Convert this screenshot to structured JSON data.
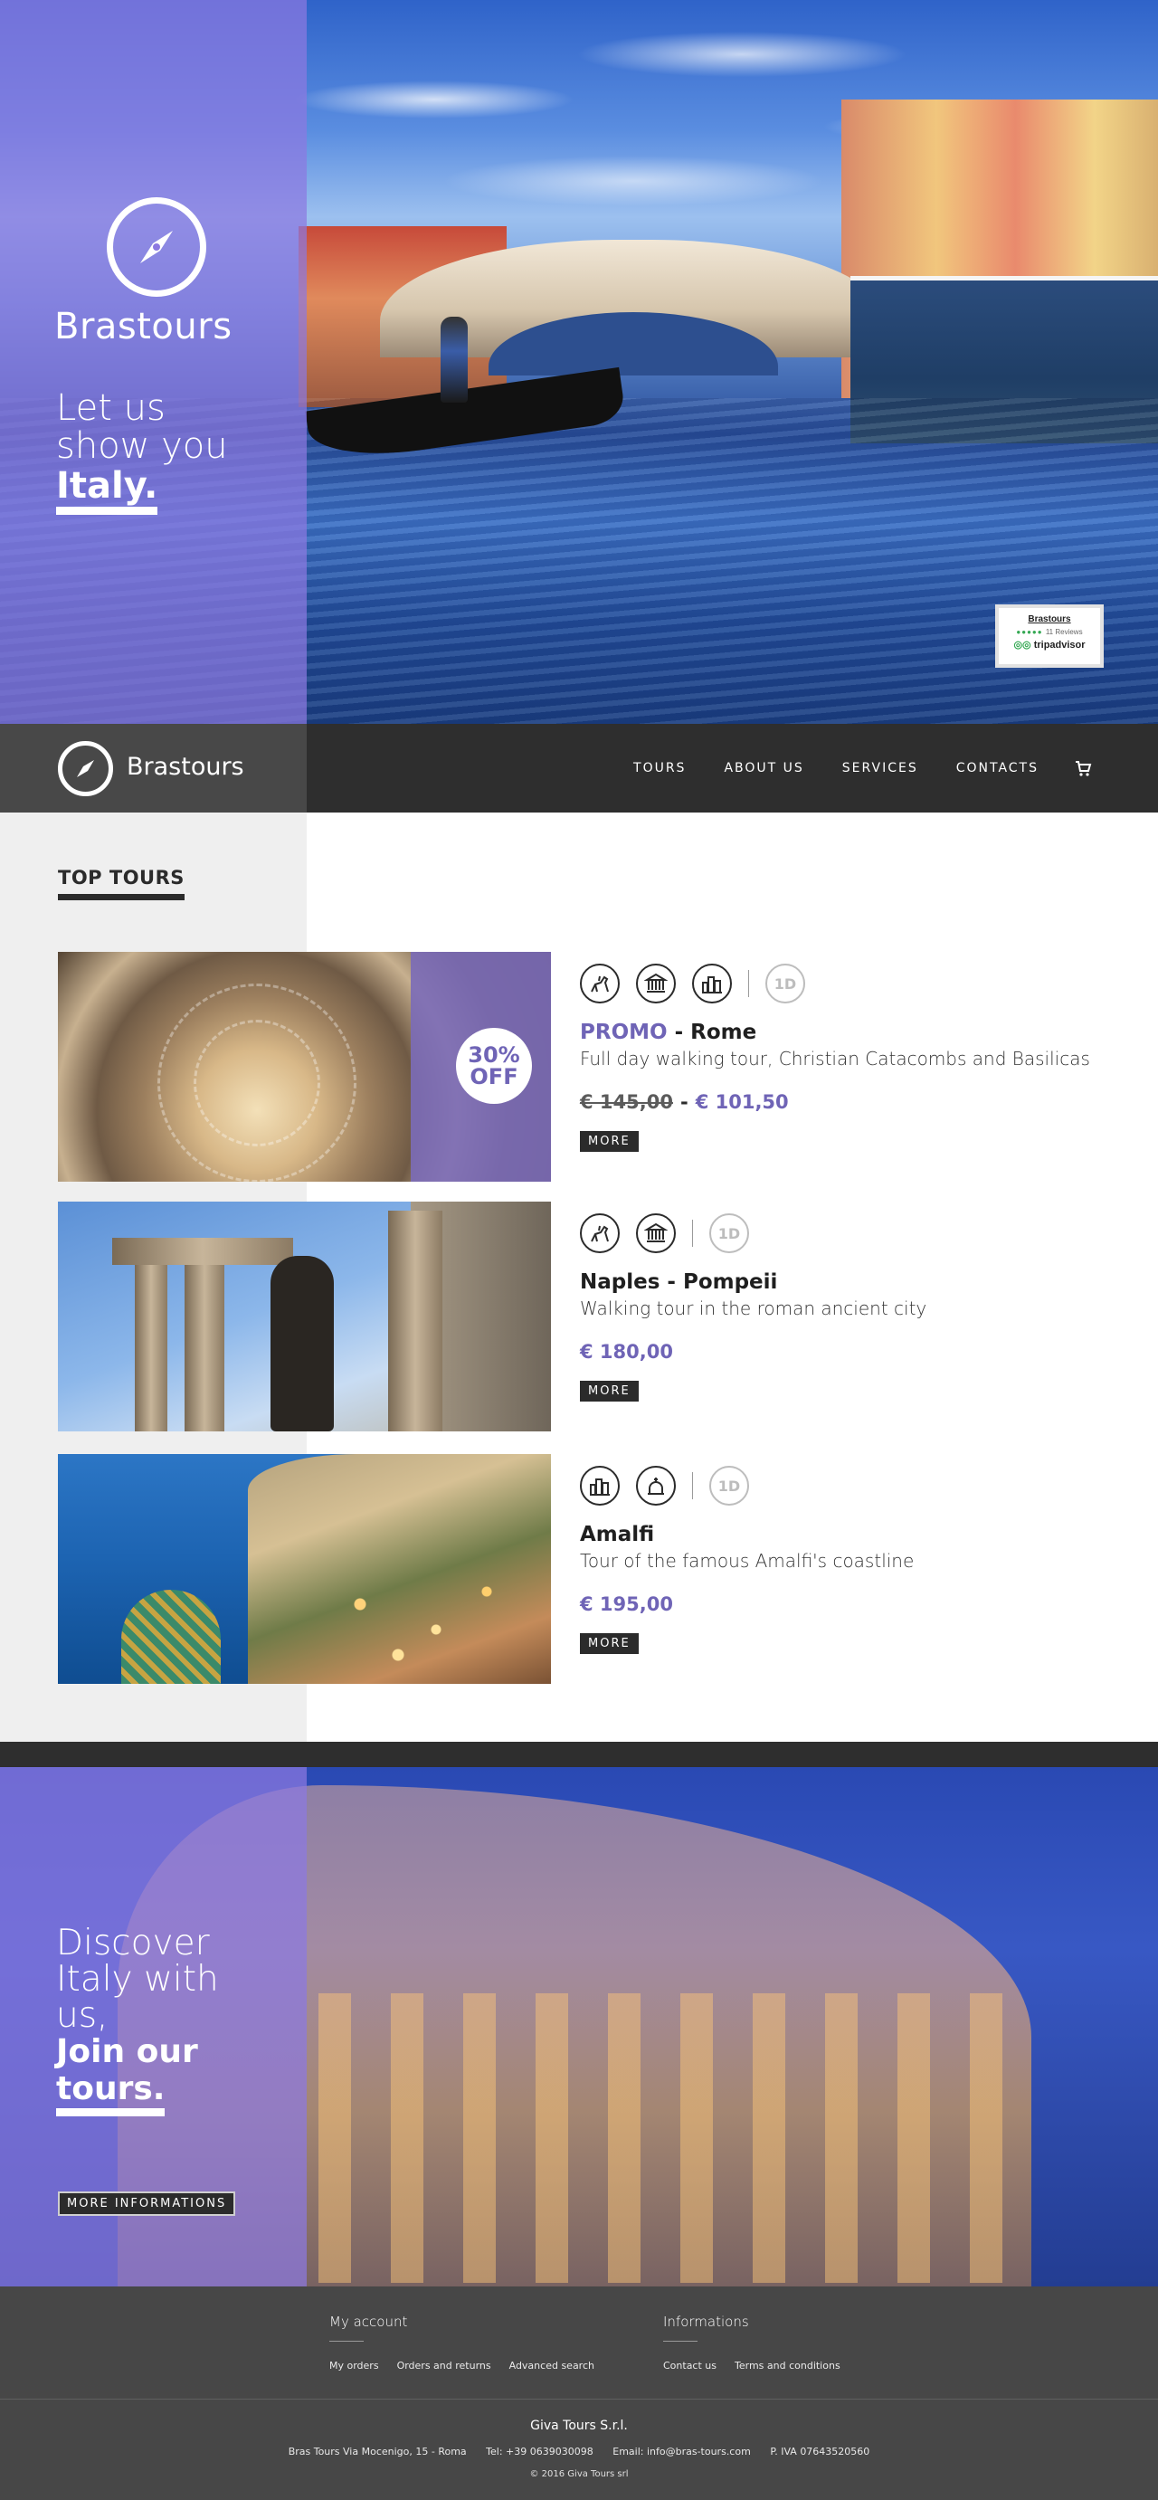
{
  "hero": {
    "brand": "Brastours",
    "tagline_line1": "Let us",
    "tagline_line2": "show you",
    "tagline_bold": "Italy.",
    "badge": {
      "title": "Brastours",
      "reviews": "11 Reviews",
      "logo_text": "tripadvisor"
    }
  },
  "nav": {
    "brand": "Brastours",
    "links": [
      "TOURS",
      "ABOUT US",
      "SERVICES",
      "CONTACTS"
    ],
    "cart_icon": "cart-icon"
  },
  "top_tours": {
    "title": "TOP TOURS",
    "tours": [
      {
        "promo_label": "PROMO",
        "name": " - Rome",
        "description": "Full day walking tour, Christian Catacombs and Basilicas",
        "old_price": "€ 145,00",
        "price": "€ 101,50",
        "discount_line1": "30%",
        "discount_line2": "OFF",
        "icons": [
          "horse-rider-icon",
          "museum-icon",
          "city-buildings-icon"
        ],
        "duration": "1D",
        "more": "MORE"
      },
      {
        "name": "Naples - Pompeii",
        "description": "Walking tour in the roman ancient city",
        "price": "€ 180,00",
        "icons": [
          "horse-rider-icon",
          "museum-icon"
        ],
        "duration": "1D",
        "more": "MORE"
      },
      {
        "name": "Amalfi",
        "description": "Tour of the famous Amalfi's coastline",
        "price": "€ 195,00",
        "icons": [
          "city-buildings-icon",
          "church-dome-icon"
        ],
        "duration": "1D",
        "more": "MORE"
      }
    ]
  },
  "discover": {
    "line1": "Discover",
    "line2": "Italy with",
    "line3": "us,",
    "bold1": "Join our",
    "bold2": "tours.",
    "button": "MORE INFORMATIONS"
  },
  "footer": {
    "account": {
      "title": "My account",
      "links": [
        "My orders",
        "Orders and returns",
        "Advanced search"
      ]
    },
    "informations": {
      "title": "Informations",
      "links": [
        "Contact us",
        "Terms and conditions"
      ]
    },
    "company": "Giva Tours S.r.l.",
    "address": "Bras Tours Via Mocenigo, 15 - Roma",
    "phone": "Tel: +39 0639030098",
    "email": "Email: info@bras-tours.com",
    "vat": "P. IVA 07643520560",
    "copyright": "© 2016 Giva Tours srl"
  },
  "colors": {
    "accent": "#6f64b6",
    "panel": "#8c78e1",
    "dark": "#2e2e2e",
    "footer": "#474747"
  }
}
